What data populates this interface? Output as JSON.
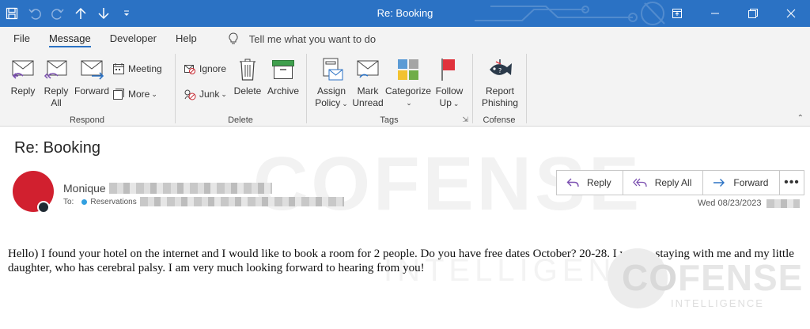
{
  "window": {
    "title": "Re: Booking",
    "titlebar_color": "#2b72c4"
  },
  "quick_access": {
    "icons": [
      "save-icon",
      "undo-icon",
      "redo-icon",
      "up-arrow-icon",
      "down-arrow-icon",
      "customize-icon"
    ]
  },
  "ribbon_tabs": {
    "file": "File",
    "message": "Message",
    "developer": "Developer",
    "help": "Help",
    "tell_me": "Tell me what you want to do"
  },
  "ribbon": {
    "respond": {
      "label": "Respond",
      "reply": "Reply",
      "reply_all_1": "Reply",
      "reply_all_2": "All",
      "forward": "Forward",
      "meeting": "Meeting",
      "more": "More"
    },
    "delete": {
      "label": "Delete",
      "ignore": "Ignore",
      "junk": "Junk",
      "delete": "Delete",
      "archive": "Archive"
    },
    "tags": {
      "label": "Tags",
      "assign_1": "Assign",
      "assign_2": "Policy",
      "mark_1": "Mark",
      "mark_2": "Unread",
      "categorize": "Categorize",
      "follow_1": "Follow",
      "follow_2": "Up"
    },
    "cofense": {
      "label": "Cofense",
      "report_1": "Report",
      "report_2": "Phishing"
    }
  },
  "message": {
    "subject": "Re: Booking",
    "sender": "Monique",
    "to_label": "To:",
    "recipient": "Reservations",
    "date": "Wed 08/23/2023",
    "body": "Hello) I found your hotel on the internet and I would like to book a room for 2 people. Do you have free dates October? 20-28.  I will be staying with me and my little daughter, who has cerebral palsy. I am very much looking forward to hearing from you!",
    "avatar_color": "#d1202f"
  },
  "reading_actions": {
    "reply": "Reply",
    "reply_all": "Reply All",
    "forward": "Forward"
  },
  "watermark": {
    "big": "COFENSE",
    "sub": "INTELLIGENCE",
    "logo_co": "CO",
    "logo_fense": "FENSE",
    "logo_sub": "INTELLIGENCE"
  }
}
